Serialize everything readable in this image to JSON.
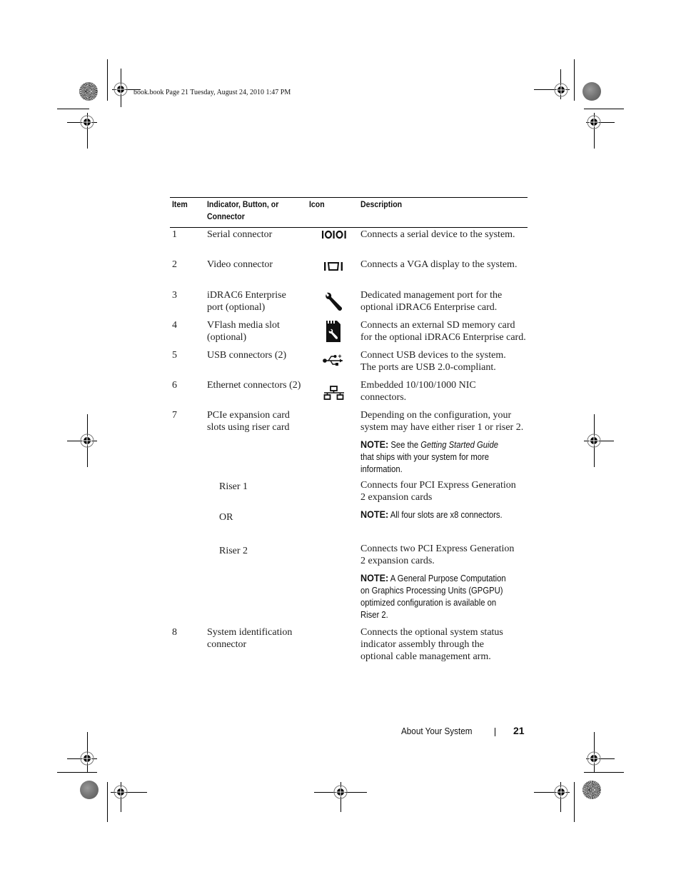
{
  "slug": "book.book  Page 21  Tuesday, August 24, 2010  1:47 PM",
  "table": {
    "headers": {
      "item": "Item",
      "indicator_line1": "Indicator, Button, or",
      "indicator_line2": "Connector",
      "icon": "Icon",
      "description": "Description"
    },
    "rows": [
      {
        "item": "1",
        "name": [
          "Serial connector"
        ],
        "icon": "serial-icon",
        "desc": [
          "Connects a serial device to the system."
        ]
      },
      {
        "item": "2",
        "name": [
          "Video connector"
        ],
        "icon": "video-icon",
        "desc": [
          "Connects a VGA display to the system."
        ]
      },
      {
        "item": "3",
        "name": [
          "iDRAC6 Enterprise",
          "port (optional)"
        ],
        "icon": "wrench-icon",
        "desc": [
          "Dedicated management port for the",
          "optional iDRAC6 Enterprise card."
        ]
      },
      {
        "item": "4",
        "name": [
          "VFlash media slot",
          "(optional)"
        ],
        "icon": "sd-card-icon",
        "desc": [
          "Connects an external SD memory card",
          "for the optional iDRAC6 Enterprise card."
        ]
      },
      {
        "item": "5",
        "name": [
          "USB connectors (2)"
        ],
        "icon": "usb-icon",
        "desc": [
          "Connect USB devices to the system.",
          "The ports are USB 2.0-compliant."
        ]
      },
      {
        "item": "6",
        "name": [
          "Ethernet connectors (2)"
        ],
        "icon": "network-icon",
        "desc": [
          "Embedded 10/100/1000 NIC",
          "connectors."
        ]
      },
      {
        "item": "7",
        "name": [
          "PCIe expansion card",
          "slots using riser card"
        ],
        "icon": "",
        "desc": [
          "Depending on the configuration, your",
          "system may have either riser 1 or riser 2."
        ],
        "note": {
          "label": "NOTE:",
          "pre": " See the ",
          "italic": "Getting Started Guide",
          "line2": "that ships with your system for more",
          "line3": "information."
        }
      },
      {
        "item": "",
        "name": [
          "Riser 1"
        ],
        "icon": "",
        "desc": [
          "Connects four PCI Express Generation",
          "2 expansion cards"
        ]
      },
      {
        "item": "",
        "name": [
          "OR"
        ],
        "icon": "",
        "desc": [],
        "note": {
          "label": "NOTE:",
          "text": " All four slots are x8 connectors."
        }
      },
      {
        "item": "",
        "name": [
          "Riser 2"
        ],
        "icon": "",
        "desc": [
          "Connects two PCI Express Generation",
          "2 expansion cards."
        ],
        "note": {
          "label": "NOTE:",
          "text": " A General Purpose Computation",
          "line2": "on Graphics Processing Units (GPGPU)",
          "line3": "optimized configuration is available on",
          "line4": "Riser 2."
        }
      },
      {
        "item": "8",
        "name": [
          "System identification",
          "connector"
        ],
        "icon": "",
        "desc": [
          "Connects the optional system status",
          "indicator assembly through the",
          "optional cable management arm."
        ]
      }
    ]
  },
  "footer": {
    "section": "About Your System",
    "page": "21"
  }
}
